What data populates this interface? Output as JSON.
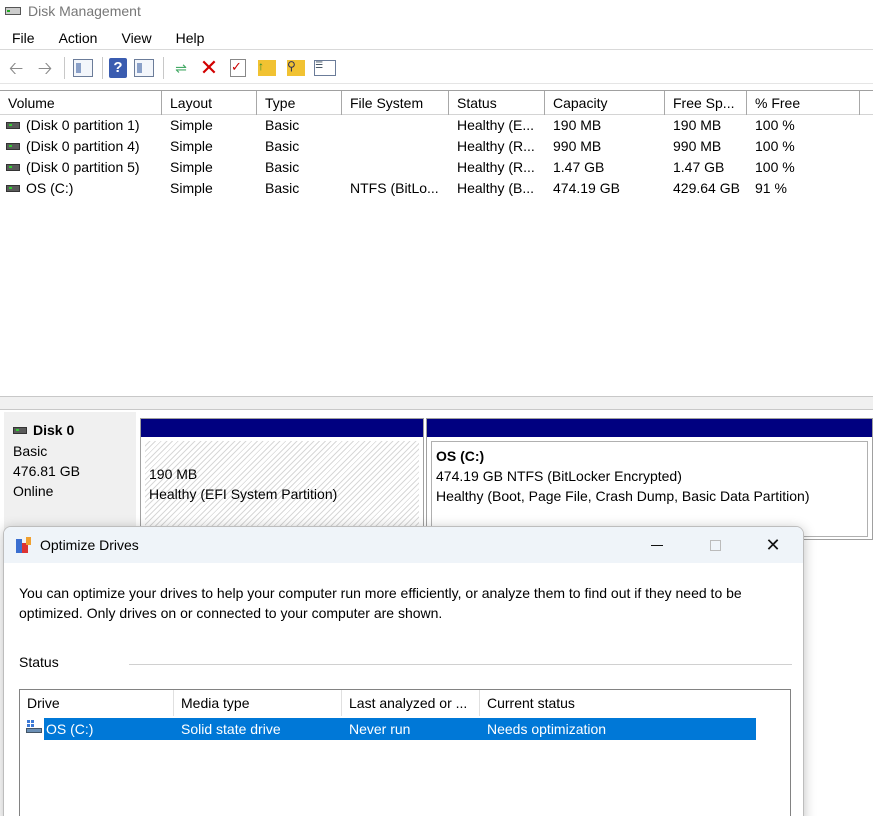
{
  "window": {
    "title": "Disk Management"
  },
  "menu": [
    "File",
    "Action",
    "View",
    "Help"
  ],
  "volumes": {
    "columns": [
      "Volume",
      "Layout",
      "Type",
      "File System",
      "Status",
      "Capacity",
      "Free Sp...",
      "% Free"
    ],
    "rows": [
      [
        "(Disk 0 partition 1)",
        "Simple",
        "Basic",
        "",
        "Healthy (E...",
        "190 MB",
        "190 MB",
        "100 %"
      ],
      [
        "(Disk 0 partition 4)",
        "Simple",
        "Basic",
        "",
        "Healthy (R...",
        "990 MB",
        "990 MB",
        "100 %"
      ],
      [
        "(Disk 0 partition 5)",
        "Simple",
        "Basic",
        "",
        "Healthy (R...",
        "1.47 GB",
        "1.47 GB",
        "100 %"
      ],
      [
        "OS (C:)",
        "Simple",
        "Basic",
        "NTFS (BitLo...",
        "Healthy (B...",
        "474.19 GB",
        "429.64 GB",
        "91 %"
      ]
    ]
  },
  "disk": {
    "name": "Disk 0",
    "type": "Basic",
    "size": "476.81 GB",
    "state": "Online"
  },
  "partitions": {
    "efi": {
      "size": "190 MB",
      "status": "Healthy (EFI System Partition)"
    },
    "os": {
      "title": "OS  (C:)",
      "size": "474.19 GB NTFS (BitLocker Encrypted)",
      "status": "Healthy (Boot, Page File, Crash Dump, Basic Data Partition)"
    }
  },
  "dialog": {
    "title": "Optimize Drives",
    "description": "You can optimize your drives to help your computer run more efficiently, or analyze them to find out if they need to be optimized. Only drives on or connected to your computer are shown.",
    "status_label": "Status",
    "columns": [
      "Drive",
      "Media type",
      "Last analyzed or ...",
      "Current status"
    ],
    "rows": [
      {
        "drive": "OS (C:)",
        "media": "Solid state drive",
        "last": "Never run",
        "status": "Needs optimization"
      }
    ]
  },
  "colors": {
    "partition_cap": "#000080",
    "selection": "#0078d7",
    "delete_icon": "#d20000"
  },
  "icons": [
    "back-arrow-icon",
    "forward-arrow-icon",
    "console-tree-icon",
    "help-icon",
    "action-pane-icon",
    "connect-icon",
    "delete-icon",
    "properties-check-icon",
    "folder-up-icon",
    "folder-search-icon",
    "properties-icon"
  ]
}
